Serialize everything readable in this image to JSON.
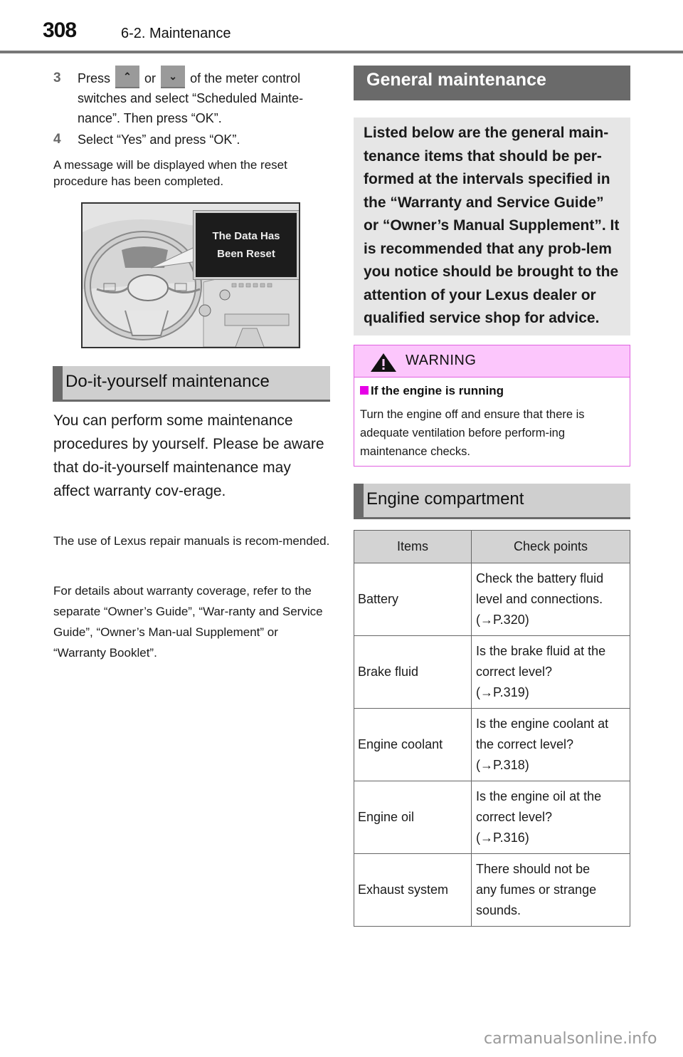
{
  "header": {
    "page_number": "308",
    "section": "6-2. Maintenance"
  },
  "steps": [
    {
      "number": "3",
      "text_before": "Press",
      "button_up_glyph": "⌃",
      "text_or": "or",
      "button_down_glyph": "⌄",
      "text_after": "of the meter control switches and select “Scheduled Mainte-nance”. Then press “OK”."
    },
    {
      "number": "4",
      "text": "Select “Yes” and press “OK”."
    }
  ],
  "reset_note": "A message will be displayed when the reset procedure has been completed.",
  "figure": {
    "callout_line1": "The Data Has",
    "callout_line2": "Been Reset"
  },
  "diy": {
    "heading": "Do-it-yourself maintenance",
    "intro": "You can perform some maintenance procedures by yourself. Please be aware that do-it-yourself maintenance may affect warranty cov-erage.",
    "para1": "The use of Lexus repair manuals is recom-mended.",
    "para2": "For details about warranty coverage, refer to the separate “Owner’s Guide”, “War-ranty and Service Guide”, “Owner’s Man-ual Supplement” or “Warranty Booklet”."
  },
  "general": {
    "heading": "General maintenance",
    "body": "Listed below are the general main-tenance items that should be per-formed at the intervals specified in the “Warranty and Service Guide” or “Owner’s Manual Supplement”. It is recommended that any prob-lem you notice should be brought to the attention of your Lexus dealer or qualified service shop for advice."
  },
  "warning": {
    "title": "WARNING",
    "subheading": "If the engine is running",
    "text": "Turn the engine off and ensure that there is adequate ventilation before perform-ing maintenance checks.",
    "accent_color": "#e600e6",
    "header_bg": "#fcc6fc"
  },
  "engine_compartment": {
    "heading": "Engine compartment",
    "columns": [
      "Items",
      "Check points"
    ],
    "rows": [
      {
        "item": "Battery",
        "check_lines": [
          "Check the battery fluid",
          "level and connections.",
          "(→P.320)"
        ]
      },
      {
        "item": "Brake fluid",
        "check_lines": [
          "Is the brake fluid at the",
          "correct level?",
          "(→P.319)"
        ]
      },
      {
        "item": "Engine coolant",
        "check_lines": [
          "Is the engine coolant at",
          "the correct level?",
          "(→P.318)"
        ]
      },
      {
        "item": "Engine oil",
        "check_lines": [
          "Is the engine oil at the",
          "correct level?",
          "(→P.316)"
        ]
      },
      {
        "item": "Exhaust system",
        "check_lines": [
          "There should not be",
          "any fumes or strange",
          "sounds."
        ]
      }
    ]
  },
  "watermark": "carmanualsonline.info"
}
